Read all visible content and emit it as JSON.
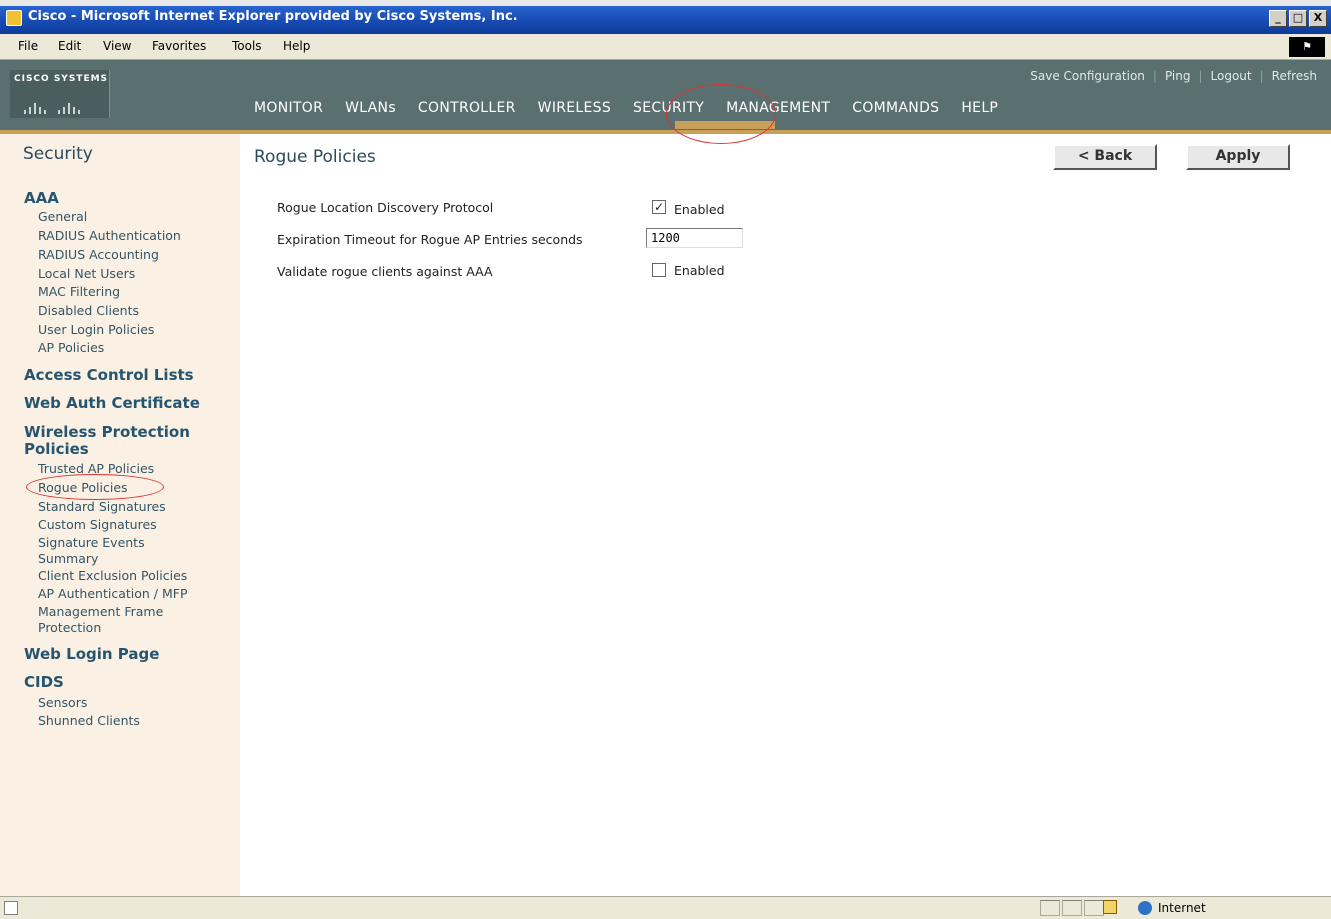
{
  "window": {
    "title": "Cisco - Microsoft Internet Explorer provided by Cisco Systems, Inc.",
    "buttons": [
      "_",
      "□",
      "X"
    ]
  },
  "menubar": {
    "items": [
      "File",
      "Edit",
      "View",
      "Favorites",
      "Tools",
      "Help"
    ]
  },
  "header": {
    "logo_text": "CISCO SYSTEMS",
    "top_links": [
      "Save Configuration",
      "Ping",
      "Logout",
      "Refresh"
    ],
    "nav": [
      "MONITOR",
      "WLANs",
      "CONTROLLER",
      "WIRELESS",
      "SECURITY",
      "MANAGEMENT",
      "COMMANDS",
      "HELP"
    ],
    "active_nav": "SECURITY"
  },
  "sidebar": {
    "title": "Security",
    "groups": [
      {
        "label": "AAA",
        "items": [
          "General",
          "RADIUS Authentication",
          "RADIUS Accounting",
          "Local Net Users",
          "MAC Filtering",
          "Disabled Clients",
          "User Login Policies",
          "AP Policies"
        ]
      },
      {
        "label": "Access Control Lists",
        "items": []
      },
      {
        "label": "Web Auth Certificate",
        "items": []
      },
      {
        "label": "Wireless Protection Policies",
        "items": [
          "Trusted AP Policies",
          "Rogue Policies",
          "Standard Signatures",
          "Custom Signatures",
          "Signature Events Summary",
          "Client Exclusion Policies",
          "AP Authentication / MFP",
          "Management Frame Protection"
        ]
      },
      {
        "label": "Web Login Page",
        "items": []
      },
      {
        "label": "CIDS",
        "items": [
          "Sensors",
          "Shunned Clients"
        ]
      }
    ],
    "active_item": "Rogue Policies"
  },
  "main": {
    "title": "Rogue Policies",
    "back_label": "< Back",
    "apply_label": "Apply",
    "rows": [
      {
        "label": "Rogue Location Discovery Protocol",
        "checked": true,
        "option": "Enabled"
      },
      {
        "label": "Expiration Timeout for Rogue AP Entries seconds",
        "value": "1200"
      },
      {
        "label": "Validate rogue clients against AAA",
        "checked": false,
        "option": "Enabled"
      }
    ]
  },
  "statusbar": {
    "zone": "Internet"
  },
  "colors": {
    "header_bg": "#5a6f70",
    "accent": "#c9a05a",
    "sidebar_bg": "#fbf0e4",
    "highlight": "#dd3333"
  }
}
